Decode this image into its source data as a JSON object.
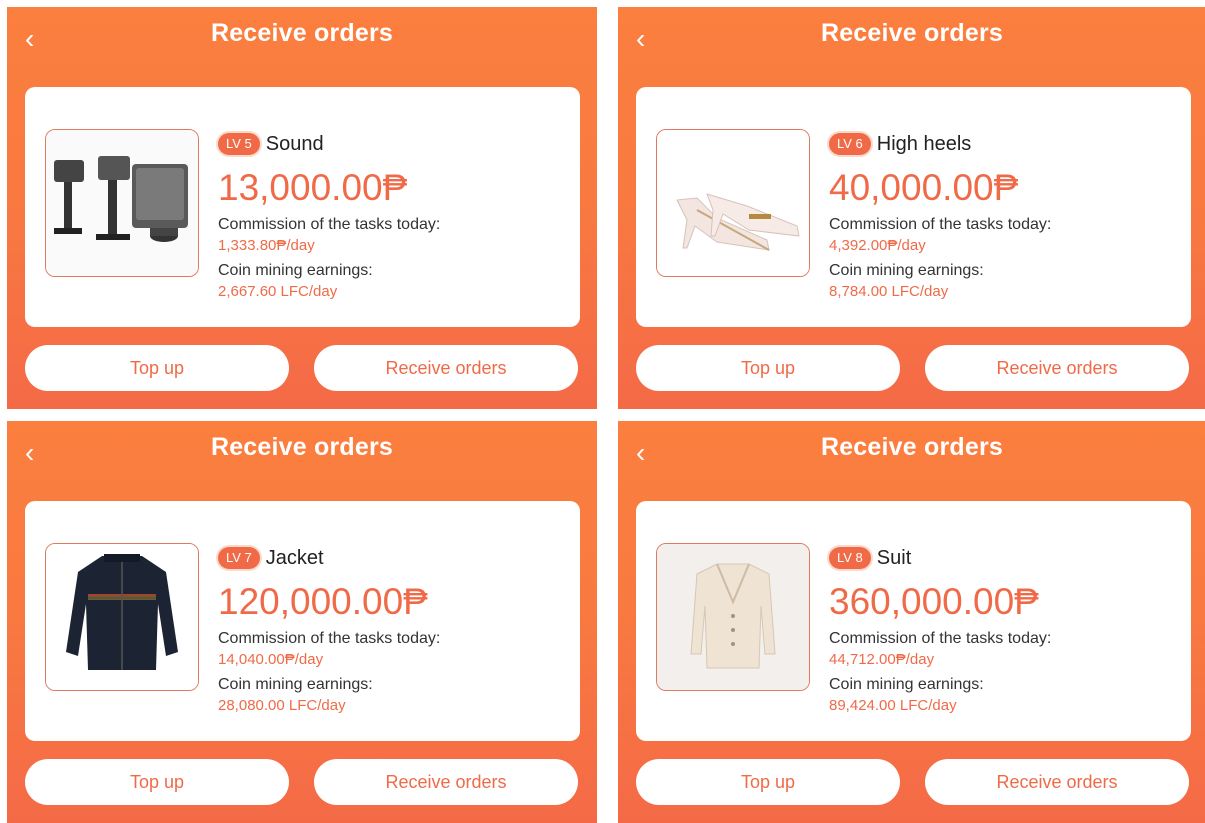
{
  "panels": [
    {
      "title": "Receive orders",
      "level": "LV 5",
      "name": "Sound",
      "price": "13,000.00₱",
      "commission_label": "Commission of the tasks today:",
      "commission_value": "1,333.80₱/day",
      "mining_label": "Coin mining earnings:",
      "mining_value": "2,667.60 LFC/day",
      "top_up_label": "Top up",
      "receive_label": "Receive orders",
      "image_icon": "speaker-system-image"
    },
    {
      "title": "Receive orders",
      "level": "LV 6",
      "name": "High heels",
      "price": "40,000.00₱",
      "commission_label": "Commission of the tasks today:",
      "commission_value": "4,392.00₱/day",
      "mining_label": "Coin mining earnings:",
      "mining_value": "8,784.00 LFC/day",
      "top_up_label": "Top up",
      "receive_label": "Receive orders",
      "image_icon": "high-heels-image"
    },
    {
      "title": "Receive orders",
      "level": "LV 7",
      "name": "Jacket",
      "price": "120,000.00₱",
      "commission_label": "Commission of the tasks today:",
      "commission_value": "14,040.00₱/day",
      "mining_label": "Coin mining earnings:",
      "mining_value": "28,080.00 LFC/day",
      "top_up_label": "Top up",
      "receive_label": "Receive orders",
      "image_icon": "jacket-image"
    },
    {
      "title": "Receive orders",
      "level": "LV 8",
      "name": "Suit",
      "price": "360,000.00₱",
      "commission_label": "Commission of the tasks today:",
      "commission_value": "44,712.00₱/day",
      "mining_label": "Coin mining earnings:",
      "mining_value": "89,424.00 LFC/day",
      "top_up_label": "Top up",
      "receive_label": "Receive orders",
      "image_icon": "suit-blazer-image"
    }
  ],
  "back_icon": "chevron-left-icon",
  "colors": {
    "accent": "#f06a48",
    "header_gradient_top": "#fb7f3f",
    "header_gradient_bottom": "#f46a47"
  }
}
